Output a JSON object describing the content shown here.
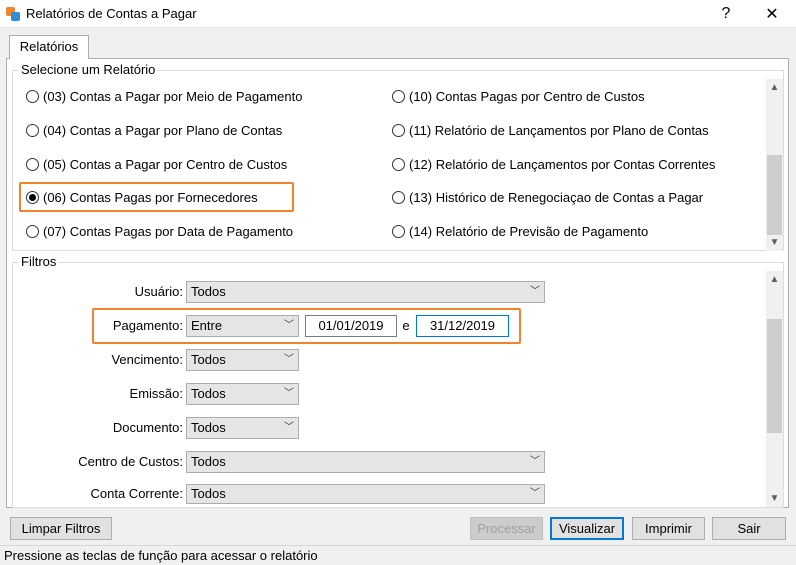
{
  "window": {
    "title": "Relatórios de Contas a Pagar",
    "help_label": "?",
    "close_label": "✕"
  },
  "tab": {
    "label": "Relatórios"
  },
  "report_group": {
    "legend": "Selecione um Relatório",
    "left_items": [
      {
        "label": "(03) Contas a Pagar por Meio de Pagamento",
        "selected": false
      },
      {
        "label": "(04) Contas a Pagar por Plano de Contas",
        "selected": false
      },
      {
        "label": "(05) Contas a Pagar por Centro de Custos",
        "selected": false
      },
      {
        "label": "(06) Contas Pagas por Fornecedores",
        "selected": true
      },
      {
        "label": "(07) Contas Pagas por Data de Pagamento",
        "selected": false
      }
    ],
    "right_items": [
      {
        "label": "(10) Contas Pagas por Centro de Custos",
        "selected": false
      },
      {
        "label": "(11) Relatório de Lançamentos por Plano de Contas",
        "selected": false
      },
      {
        "label": "(12) Relatório de Lançamentos por Contas Correntes",
        "selected": false
      },
      {
        "label": "(13) Histórico de Renegociaçao de Contas a Pagar",
        "selected": false
      },
      {
        "label": "(14) Relatório de Previsão de Pagamento",
        "selected": false
      }
    ]
  },
  "filters": {
    "legend": "Filtros",
    "usuario": {
      "label": "Usuário:",
      "value": "Todos"
    },
    "pagamento": {
      "label": "Pagamento:",
      "value": "Entre",
      "from": "01/01/2019",
      "sep": "e",
      "to": "31/12/2019"
    },
    "vencimento": {
      "label": "Vencimento:",
      "value": "Todos"
    },
    "emissao": {
      "label": "Emissão:",
      "value": "Todos"
    },
    "documento": {
      "label": "Documento:",
      "value": "Todos"
    },
    "centro_custos": {
      "label": "Centro de Custos:",
      "value": "Todos"
    },
    "conta_corrente": {
      "label": "Conta Corrente:",
      "value": "Todos"
    }
  },
  "buttons": {
    "limpar": "Limpar Filtros",
    "processar": "Processar",
    "visualizar": "Visualizar",
    "imprimir": "Imprimir",
    "sair": "Sair"
  },
  "status": "Pressione as teclas de função para acessar o relatório",
  "colors": {
    "highlight": "#f0842c",
    "focus": "#0078d7"
  }
}
